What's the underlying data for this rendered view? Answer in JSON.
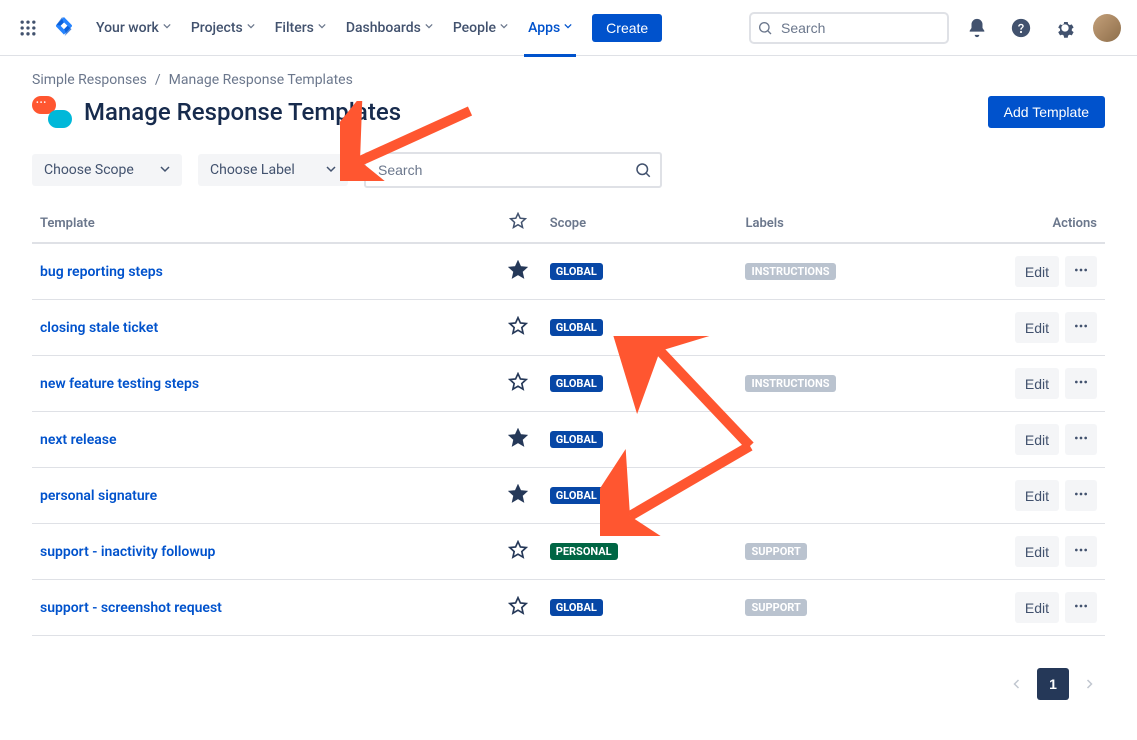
{
  "nav": {
    "items": [
      "Your work",
      "Projects",
      "Filters",
      "Dashboards",
      "People",
      "Apps"
    ],
    "activeIndex": 5,
    "create": "Create",
    "searchPlaceholder": "Search"
  },
  "breadcrumb": {
    "root": "Simple Responses",
    "current": "Manage Response Templates"
  },
  "page": {
    "title": "Manage Response Templates",
    "addButton": "Add Template"
  },
  "filters": {
    "scope": "Choose Scope",
    "label": "Choose Label",
    "searchPlaceholder": "Search"
  },
  "table": {
    "headers": {
      "template": "Template",
      "scope": "Scope",
      "labels": "Labels",
      "actions": "Actions"
    },
    "rows": [
      {
        "name": "bug reporting steps",
        "starred": true,
        "scope": "GLOBAL",
        "labels": [
          "INSTRUCTIONS"
        ]
      },
      {
        "name": "closing stale ticket",
        "starred": false,
        "scope": "GLOBAL",
        "labels": []
      },
      {
        "name": "new feature testing steps",
        "starred": false,
        "scope": "GLOBAL",
        "labels": [
          "INSTRUCTIONS"
        ]
      },
      {
        "name": "next release",
        "starred": true,
        "scope": "GLOBAL",
        "labels": []
      },
      {
        "name": "personal signature",
        "starred": true,
        "scope": "GLOBAL",
        "labels": []
      },
      {
        "name": "support - inactivity followup",
        "starred": false,
        "scope": "PERSONAL",
        "labels": [
          "SUPPORT"
        ]
      },
      {
        "name": "support - screenshot request",
        "starred": false,
        "scope": "GLOBAL",
        "labels": [
          "SUPPORT"
        ]
      }
    ],
    "editLabel": "Edit"
  },
  "pagination": {
    "current": "1"
  }
}
